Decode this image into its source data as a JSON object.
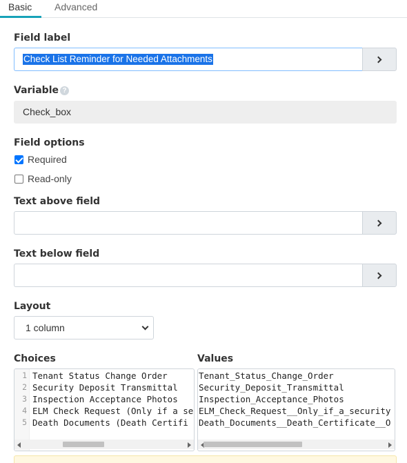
{
  "tabs": [
    {
      "label": "Basic",
      "active": true
    },
    {
      "label": "Advanced",
      "active": false
    }
  ],
  "field_label": {
    "label": "Field label",
    "value": "Check List Reminder for Needed Attachments"
  },
  "variable": {
    "label": "Variable",
    "value": "Check_box",
    "help_icon": "question-circle-icon"
  },
  "field_options": {
    "label": "Field options",
    "required": {
      "label": "Required",
      "checked": true
    },
    "read_only": {
      "label": "Read-only",
      "checked": false
    }
  },
  "text_above": {
    "label": "Text above field",
    "value": ""
  },
  "text_below": {
    "label": "Text below field",
    "value": ""
  },
  "layout": {
    "label": "Layout",
    "selected": "1 column"
  },
  "choices": {
    "label": "Choices",
    "lines": [
      "Tenant Status Change Order",
      "Security Deposit Transmittal",
      "Inspection Acceptance Photos",
      "ELM Check Request (Only if a se",
      "Death Documents (Death Certifi"
    ],
    "line_numbers": [
      "1",
      "2",
      "3",
      "4",
      "5"
    ]
  },
  "values": {
    "label": "Values",
    "lines": [
      "Tenant_Status_Change_Order",
      "Security_Deposit_Transmittal",
      "Inspection_Acceptance_Photos",
      "ELM_Check_Request__Only_if_a_security",
      "Death_Documents__Death_Certificate__O"
    ]
  },
  "colors": {
    "active_tab": "#17a2b8",
    "selection": "#1a73e8",
    "checkbox": "#0075ff"
  }
}
